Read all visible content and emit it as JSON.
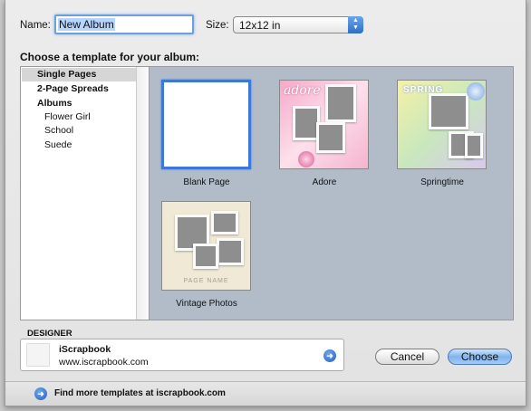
{
  "form": {
    "name_label": "Name:",
    "name_value": "New Album",
    "size_label": "Size:",
    "size_value": "12x12 in",
    "choose_label": "Choose a template for your album:"
  },
  "sidebar": {
    "items": [
      {
        "label": "Single Pages"
      },
      {
        "label": "2-Page Spreads"
      },
      {
        "label": "Albums"
      },
      {
        "label": "Flower Girl"
      },
      {
        "label": "School"
      },
      {
        "label": "Suede"
      }
    ]
  },
  "templates": [
    {
      "label": "Blank Page"
    },
    {
      "label": "Adore"
    },
    {
      "label": "Springtime"
    },
    {
      "label": "Vintage Photos"
    }
  ],
  "template_text": {
    "adore_title": "adore",
    "springtime_title": "SPRING",
    "vintage_caption": "PAGE NAME"
  },
  "designer": {
    "section_label": "DESIGNER",
    "name": "iScrapbook",
    "url": "www.iscrapbook.com"
  },
  "buttons": {
    "cancel": "Cancel",
    "choose": "Choose"
  },
  "footer": {
    "text": "Find more templates at iscrapbook.com"
  },
  "icons": {
    "arrow": "go-arrow-icon",
    "select": "updown-arrows-icon"
  },
  "colors": {
    "accent": "#3d78d8",
    "gallery_bg": "#b2bcc8"
  }
}
